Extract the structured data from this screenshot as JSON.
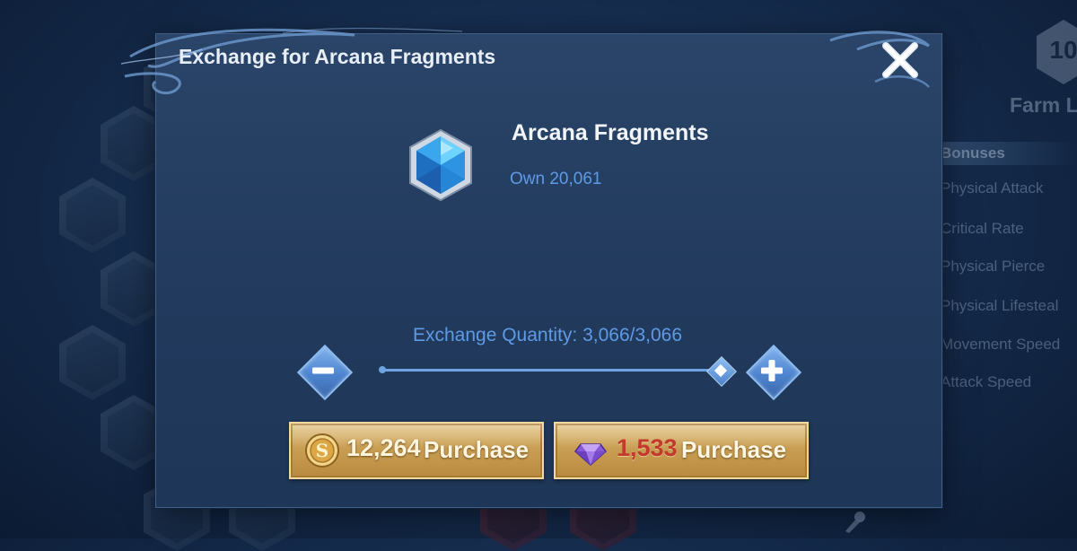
{
  "background": {
    "level_badge": "10",
    "farm_title": "Farm L",
    "bonuses_header": "Bonuses",
    "bonus_items": [
      "Physical Attack",
      "Critical Rate",
      "Physical Pierce",
      "Physical Lifesteal",
      "Movement Speed",
      "Attack Speed"
    ]
  },
  "dialog": {
    "title": "Exchange for Arcana Fragments",
    "item": {
      "name": "Arcana Fragments",
      "owned": "Own 20,061",
      "icon": "arcana-crystal-icon"
    },
    "quantity": {
      "text": "Exchange Quantity: 3,066/3,066",
      "current": 3066,
      "max": 3066
    },
    "buttons": {
      "gold_price": "12,264",
      "gold_label": "Purchase",
      "gem_price": "1,533",
      "gem_label": "Purchase"
    }
  },
  "colors": {
    "accent_blue": "#5e9ae6",
    "gold_button": "#c99f55",
    "insufficient_red": "#c23a2e"
  }
}
